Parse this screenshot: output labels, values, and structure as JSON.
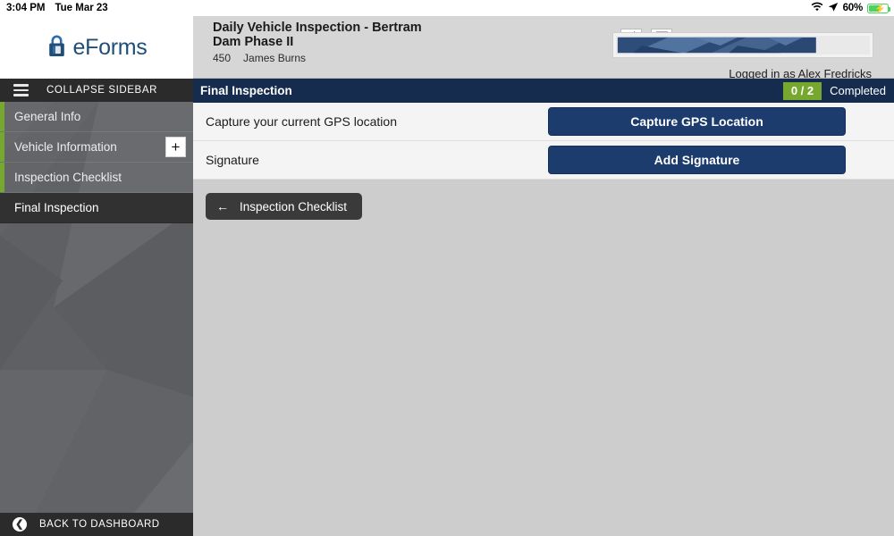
{
  "statusbar": {
    "time": "3:04 PM",
    "date": "Tue Mar 23",
    "wifi_icon": "wifi-icon",
    "location_icon": "location-arrow-icon",
    "battery_percent": "60%",
    "battery_icon": "battery-charging-icon"
  },
  "sidebar": {
    "logo_text": "eForms",
    "logo_icon": "padlock-icon",
    "collapse_label": "COLLAPSE SIDEBAR",
    "menu_icon": "hamburger-icon",
    "items": [
      {
        "label": "General Info",
        "active": false,
        "has_plus": false
      },
      {
        "label": "Vehicle Information",
        "active": false,
        "has_plus": true,
        "plus_label": "+"
      },
      {
        "label": "Inspection Checklist",
        "active": false,
        "has_plus": false
      },
      {
        "label": "Final Inspection",
        "active": true,
        "has_plus": false
      }
    ],
    "back_to_dashboard_label": "BACK TO DASHBOARD",
    "back_icon": "circle-left-arrow-icon",
    "accent_green": "#76a82f"
  },
  "header": {
    "title": "Daily Vehicle Inspection - Bertram Dam Phase II",
    "subtitle_number": "450",
    "subtitle_name": "James  Burns",
    "edit_icon": "pencil-icon",
    "mail_icon": "envelope-icon",
    "banner_icon": "company-banner-image",
    "logged_in_text": "Logged in as Alex Fredricks"
  },
  "section": {
    "title": "Final Inspection",
    "progress_badge": "0 / 2",
    "completed_label": "Completed",
    "badge_color": "#76a82f",
    "bar_color": "#152c4e"
  },
  "rows": [
    {
      "label": "Capture your current GPS location",
      "button": "Capture GPS Location"
    },
    {
      "label": "Signature",
      "button": "Add Signature"
    }
  ],
  "footer": {
    "back_button_label": "Inspection Checklist",
    "back_arrow_icon": "left-arrow-icon"
  }
}
